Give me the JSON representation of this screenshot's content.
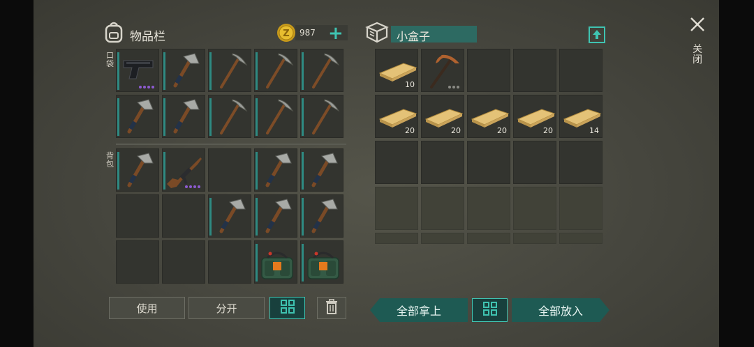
{
  "inventory": {
    "title": "物品栏",
    "coins": "987",
    "pocket_label": "口袋",
    "backpack_label": "背包",
    "pocket_slots": [
      {
        "item": "pistol-icon",
        "dots": 4,
        "dot_color": "purple"
      },
      {
        "item": "hatchet-icon"
      },
      {
        "item": "pickaxe-icon"
      },
      {
        "item": "pickaxe-icon"
      },
      {
        "item": "pickaxe-icon"
      },
      {
        "item": "hatchet-icon"
      },
      {
        "item": "hatchet-icon"
      },
      {
        "item": "pickaxe-icon"
      },
      {
        "item": "pickaxe-icon"
      },
      {
        "item": "pickaxe-icon"
      }
    ],
    "backpack_slots": [
      {
        "item": "hatchet-icon"
      },
      {
        "item": "rifle-icon",
        "dots": 4,
        "dot_color": "purple"
      },
      {
        "item": ""
      },
      {
        "item": "hatchet-icon"
      },
      {
        "item": "hatchet-icon"
      },
      {
        "item": ""
      },
      {
        "item": ""
      },
      {
        "item": "hatchet-icon"
      },
      {
        "item": "hatchet-icon"
      },
      {
        "item": "hatchet-icon"
      },
      {
        "item": ""
      },
      {
        "item": ""
      },
      {
        "item": ""
      },
      {
        "item": "explosive-pack-icon"
      },
      {
        "item": "explosive-pack-icon"
      }
    ],
    "buttons": {
      "use": "使用",
      "split": "分开"
    }
  },
  "container": {
    "title": "小盒子",
    "slots": [
      {
        "item": "wood-plank-icon",
        "qty": "10"
      },
      {
        "item": "copper-pickaxe-icon",
        "dots": 3,
        "dot_color": "grey"
      },
      {
        "item": ""
      },
      {
        "item": ""
      },
      {
        "item": ""
      },
      {
        "item": "wood-plank-icon",
        "qty": "20"
      },
      {
        "item": "wood-plank-icon",
        "qty": "20"
      },
      {
        "item": "wood-plank-icon",
        "qty": "20"
      },
      {
        "item": "wood-plank-icon",
        "qty": "20"
      },
      {
        "item": "wood-plank-icon",
        "qty": "14"
      },
      {
        "item": ""
      },
      {
        "item": ""
      },
      {
        "item": ""
      },
      {
        "item": ""
      },
      {
        "item": ""
      }
    ],
    "locked_rows": 2,
    "buttons": {
      "take_all": "全部拿上",
      "put_all": "全部放入"
    }
  },
  "close_label": "关闭",
  "colors": {
    "accent": "#3fc3b1",
    "teal_dark": "#18403d",
    "durability": "#2e8a82",
    "rarity_purple": "#8d5bd1"
  }
}
